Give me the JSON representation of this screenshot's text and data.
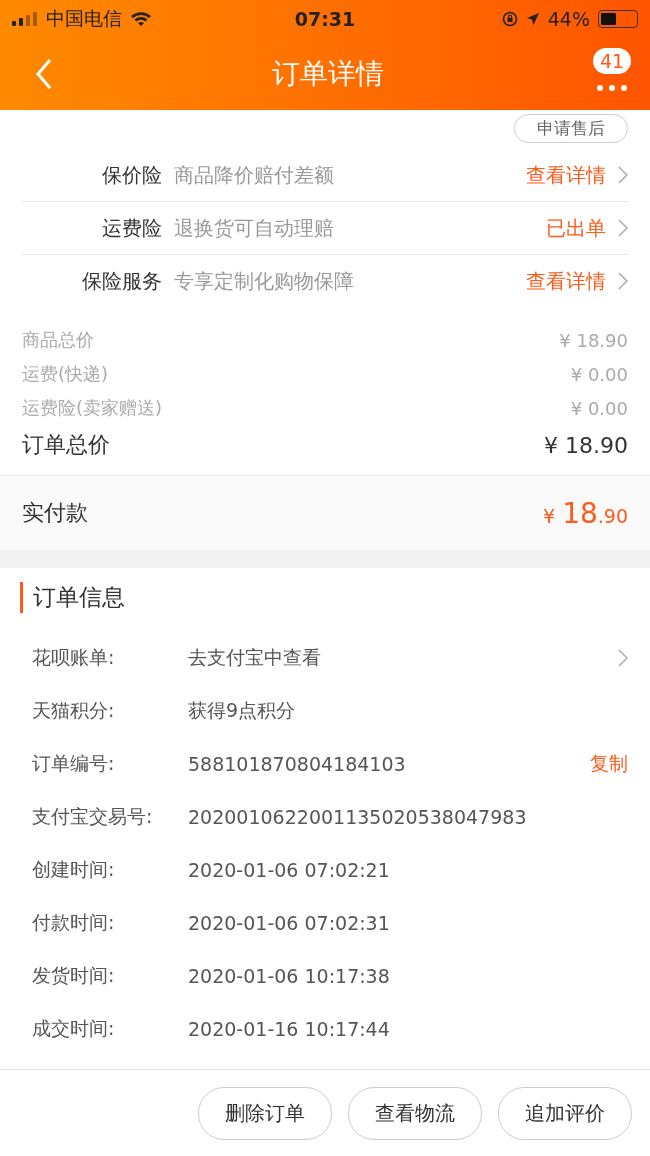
{
  "status_bar": {
    "carrier": "中国电信",
    "time": "07:31",
    "battery": "44%"
  },
  "nav": {
    "title": "订单详情",
    "badge": "41"
  },
  "after_sale_button": "申请售后",
  "insurance": [
    {
      "label": "保价险",
      "desc": "商品降价赔付差额",
      "action": "查看详情"
    },
    {
      "label": "运费险",
      "desc": "退换货可自动理赔",
      "action": "已出单"
    },
    {
      "label": "保险服务",
      "desc": "专享定制化购物保障",
      "action": "查看详情"
    }
  ],
  "prices": [
    {
      "label": "商品总价",
      "value": "¥ 18.90"
    },
    {
      "label": "运费(快递)",
      "value": "¥ 0.00"
    },
    {
      "label": "运费险(卖家赠送)",
      "value": "¥ 0.00"
    }
  ],
  "order_total": {
    "label": "订单总价",
    "value": "¥ 18.90"
  },
  "paid": {
    "label": "实付款",
    "currency": "¥",
    "integer": "18",
    "decimal": ".90"
  },
  "order_info": {
    "title": "订单信息",
    "rows": [
      {
        "label": "花呗账单:",
        "value": "去支付宝中查看",
        "kind": "link"
      },
      {
        "label": "天猫积分:",
        "value": "获得9点积分",
        "kind": "plain"
      },
      {
        "label": "订单编号:",
        "value": "588101870804184103",
        "kind": "copy",
        "action": "复制"
      },
      {
        "label": "支付宝交易号:",
        "value": "2020010622001135020538047983",
        "kind": "plain"
      },
      {
        "label": "创建时间:",
        "value": "2020-01-06 07:02:21",
        "kind": "plain"
      },
      {
        "label": "付款时间:",
        "value": "2020-01-06 07:02:31",
        "kind": "plain"
      },
      {
        "label": "发货时间:",
        "value": "2020-01-06 10:17:38",
        "kind": "plain"
      },
      {
        "label": "成交时间:",
        "value": "2020-01-16 10:17:44",
        "kind": "plain"
      }
    ]
  },
  "footer_buttons": [
    "删除订单",
    "查看物流",
    "追加评价"
  ]
}
